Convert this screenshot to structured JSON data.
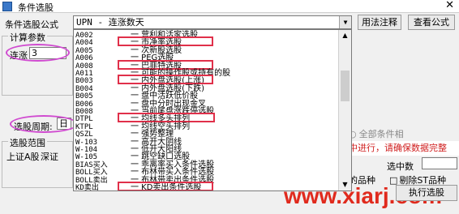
{
  "window": {
    "title": "条件选股",
    "close_glyph": "✕"
  },
  "formula": {
    "label": "条件选股公式",
    "selected": "UPN    - 连涨数天",
    "usage_button": "用法注释",
    "view_button": "查看公式"
  },
  "params": {
    "legend": "计算参数",
    "field_label": "连涨",
    "field_value": "3"
  },
  "period": {
    "label": "选股周期:",
    "value": "日"
  },
  "range": {
    "legend": "选股范围",
    "items": [
      "上证A股",
      "深证"
    ]
  },
  "right": {
    "all_conditions": "全部条件相",
    "status": "中进行，请确保数据完整",
    "selected_count_label": "选中数",
    "varieties": "的品种",
    "exclude_st": "剔除ST品种",
    "execute_button": "执行选股"
  },
  "watermark": "www.xiarj.com",
  "dropdown_items": [
    {
      "code": "A002",
      "name": "一 营利和活家选股"
    },
    {
      "code": "A004",
      "name": "一 市净率选股"
    },
    {
      "code": "A005",
      "name": "一 次新股选股"
    },
    {
      "code": "A006",
      "name": "一 PEG选股"
    },
    {
      "code": "A008",
      "name": "一 巴菲特选股"
    },
    {
      "code": "A011",
      "name": "一 可能的操作股或持有的股"
    },
    {
      "code": "B003",
      "name": "一 内外盘选股(上涨)"
    },
    {
      "code": "B004",
      "name": "一 内外盘选股(下跌)"
    },
    {
      "code": "B005",
      "name": "一 盘中活跃低价股"
    },
    {
      "code": "B006",
      "name": "一 盘中分时出现金叉"
    },
    {
      "code": "B008",
      "name": "一 当前尾盘涨跌停选股"
    },
    {
      "code": "DTPL",
      "name": "一 均线多头排列"
    },
    {
      "code": "KTPL",
      "name": "一 均线空头排列"
    },
    {
      "code": "QSZL",
      "name": "一 强势整理"
    },
    {
      "code": "W-103",
      "name": "一 高开大阴线"
    },
    {
      "code": "W-104",
      "name": "一 低开大阳线"
    },
    {
      "code": "W-105",
      "name": "一 跳空缺口选股"
    },
    {
      "code": "BIAS买入",
      "name": "一 乖离率买入条件选股"
    },
    {
      "code": "BOLL买入",
      "name": "一 布林带买入条件选股"
    },
    {
      "code": "BOLL卖出",
      "name": "一 布林带卖出条件选股"
    },
    {
      "code": "KD卖出",
      "name": "一 KD卖出条件选股"
    }
  ],
  "highlight_color": "#e0304a",
  "ellipse_color": "#d04bd0",
  "icons": {
    "dropdown_arrow": "▼",
    "scroll_up": "▲",
    "scroll_down": "▼"
  }
}
